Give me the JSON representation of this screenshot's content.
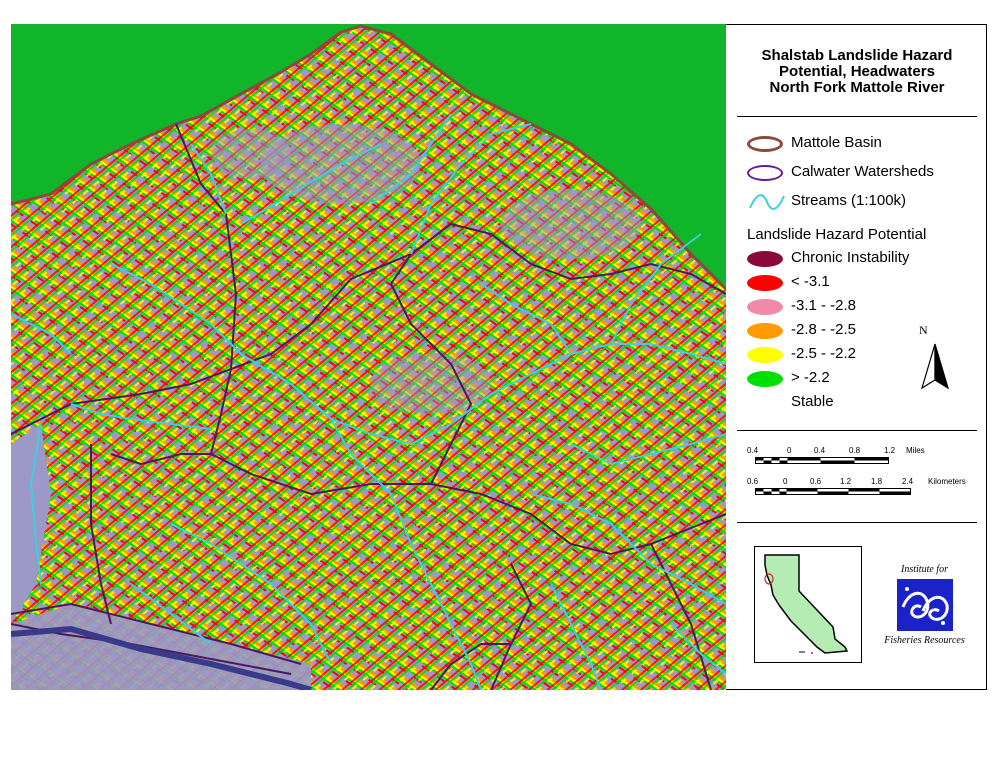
{
  "title": {
    "line1": "Shalstab Landslide Hazard",
    "line2": "Potential, Headwaters",
    "line3": "North Fork Mattole River"
  },
  "legend": {
    "features": [
      {
        "label": "Mattole Basin",
        "symbol": "ellipse-outline",
        "color": "#8b4a3c"
      },
      {
        "label": "Calwater Watersheds",
        "symbol": "ellipse-outline",
        "color": "#6a1a8a"
      },
      {
        "label": "Streams (1:100k)",
        "symbol": "wave-line",
        "color": "#3ccfe0"
      }
    ],
    "hazard_heading": "Landslide Hazard Potential",
    "hazard_classes": [
      {
        "label": "Chronic Instability",
        "color": "#8b0a3a"
      },
      {
        "label": "<  -3.1",
        "color": "#ff0000"
      },
      {
        "label": "-3.1 - -2.8",
        "color": "#f08aa8"
      },
      {
        "label": "-2.8 - -2.5",
        "color": "#ff9a00"
      },
      {
        "label": "-2.5 - -2.2",
        "color": "#ffff00"
      },
      {
        "label": "> -2.2",
        "color": "#00e000"
      },
      {
        "label": "Stable",
        "color": ""
      }
    ]
  },
  "north_arrow": {
    "label": "N"
  },
  "scale_miles": {
    "ticks": [
      "0.4",
      "0",
      "0.4",
      "0.8",
      "1.2"
    ],
    "unit": "Miles"
  },
  "scale_km": {
    "ticks": [
      "0.6",
      "0",
      "0.6",
      "1.2",
      "1.8",
      "2.4"
    ],
    "unit": "Kilometers"
  },
  "logo": {
    "line1": "Institute for",
    "line2": "Fisheries Resources"
  },
  "colors": {
    "outside_basin": "#11b52a",
    "terrain": "#9c98c8",
    "basin_outline": "#8b4a3c",
    "watershed_line": "#4a1a60",
    "stream": "#3ccfe0",
    "logo_blue": "#1a22c8"
  }
}
